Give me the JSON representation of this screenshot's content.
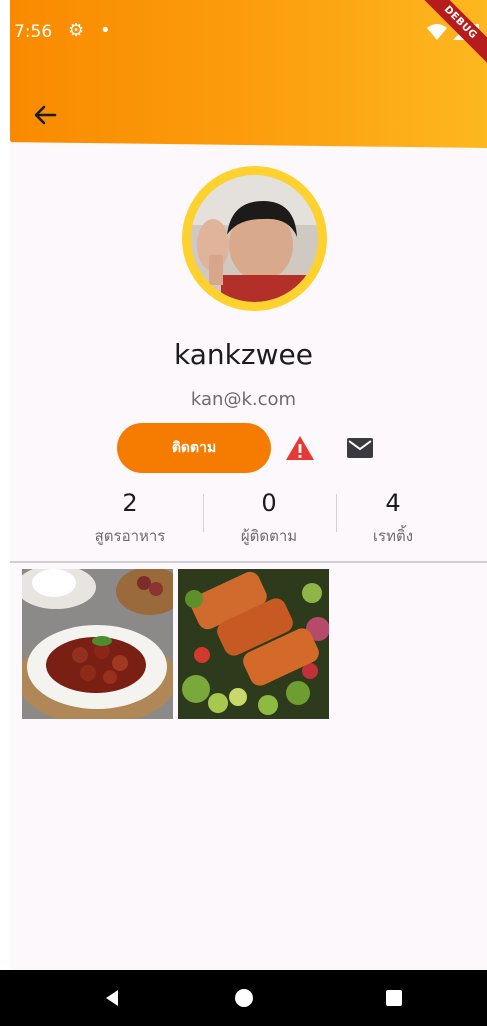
{
  "status_bar": {
    "time": "7:56",
    "debug_label": "DEBUG"
  },
  "profile": {
    "username": "kankzwee",
    "email": "kan@k.com"
  },
  "actions": {
    "follow_label": "ติดตาม"
  },
  "stats": [
    {
      "value": "2",
      "label": "สูตรอาหาร"
    },
    {
      "value": "0",
      "label": "ผู้ติดตาม"
    },
    {
      "value": "4",
      "label": "เรทติ้ง"
    }
  ],
  "colors": {
    "accent": "#f57c00",
    "header_start": "#f98a00",
    "header_end": "#fdb81f",
    "avatar_ring": "#fdd22f",
    "warning": "#e53935"
  },
  "icons": {
    "back": "arrow-left-icon",
    "report": "warning-icon",
    "message": "mail-icon"
  }
}
